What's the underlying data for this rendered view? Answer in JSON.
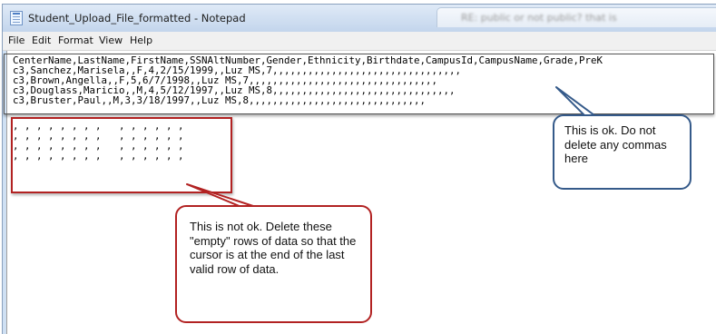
{
  "window": {
    "title": "Student_Upload_File_formatted - Notepad",
    "background_tab_text": "RE: public or not public? that is"
  },
  "menu": [
    "File",
    "Edit",
    "Format",
    "View",
    "Help"
  ],
  "editor": {
    "lines": [
      "CenterName,LastName,FirstName,SSNAltNumber,Gender,Ethnicity,Birthdate,CampusId,CampusName,Grade,PreK",
      "c3,Sanchez,Marisela,,F,4,2/15/1999,,Luz MS,7,,,,,,,,,,,,,,,,,,,,,,,,,,,,,,,,",
      "c3,Brown,Angella,,F,5,6/7/1998,,Luz MS,7,,,,,,,,,,,,,,,,,,,,,,,,,,,,,,,,",
      "c3,Douglass,Maricio,,M,4,5/12/1997,,Luz MS,8,,,,,,,,,,,,,,,,,,,,,,,,,,,,,,,",
      "c3,Bruster,Paul,,M,3,3/18/1997,,Luz MS,8,,,,,,,,,,,,,,,,,,,,,,,,,,,,,,",
      ", , , , , , , ,   , , , , , ,",
      ", , , , , , , ,   , , , , , ,",
      ", , , , , , , ,   , , , , , ,",
      ", , , , , , , ,   , , , , , ,"
    ]
  },
  "callouts": {
    "ok": "This is ok. Do not delete any commas here",
    "bad": "This is not ok. Delete these \"empty\" rows of data so that the cursor is at the end of the last valid row of data."
  },
  "colors": {
    "ok_callout_border": "#355a8a",
    "bad_callout_border": "#b22222"
  }
}
